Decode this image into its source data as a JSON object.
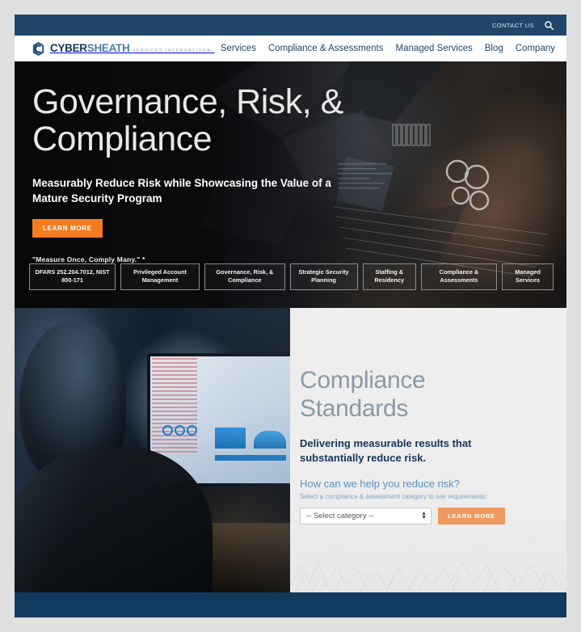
{
  "topbar": {
    "contact_label": "CONTACT US",
    "search_icon": "search-icon"
  },
  "logo": {
    "part1": "CYBER",
    "part2": "SHEATH",
    "tagline": "SERVICES INTERNATIONAL",
    "mark_icon": "cybersheath-c-shield-icon"
  },
  "nav": {
    "items": [
      {
        "label": "Services"
      },
      {
        "label": "Compliance & Assessments"
      },
      {
        "label": "Managed Services"
      },
      {
        "label": "Blog"
      },
      {
        "label": "Company"
      }
    ]
  },
  "hero": {
    "title_line1": "Governance, Risk, &",
    "title_line2": "Compliance",
    "subtitle": "Measurably Reduce Risk while Showcasing the Value of a Mature Security Program",
    "cta_label": "LEARN MORE",
    "quote": "\"Measure Once, Comply Many.\" *",
    "tabs": [
      {
        "label": "DFARS 252.204.7012, NIST 800-171"
      },
      {
        "label": "Privileged Account Management"
      },
      {
        "label": "Governance, Risk, & Compliance"
      },
      {
        "label": "Strategic Security Planning"
      },
      {
        "label": "Staffing & Residency"
      },
      {
        "label": "Compliance & Assessments"
      },
      {
        "label": "Managed Services"
      }
    ]
  },
  "compliance": {
    "title_line1": "Compliance",
    "title_line2": "Standards",
    "lead": "Delivering measurable results that substantially reduce risk.",
    "question": "How can we help you reduce risk?",
    "hint": "Select a compliance & assessment category to see requirements:",
    "select_value": "-- Select category --",
    "select_options": [
      "-- Select category --"
    ],
    "cta_label": "LEARN MORE",
    "photo_alt": "man-at-computer-photo"
  },
  "colors": {
    "topbar_navy": "#1f4669",
    "brand_navy": "#14385c",
    "brand_blue": "#4a80ab",
    "hero_orange": "#f47b20",
    "cta_peach": "#ef9a5e",
    "footer_navy": "#123a5e",
    "page_bg": "#e0e0e0"
  }
}
